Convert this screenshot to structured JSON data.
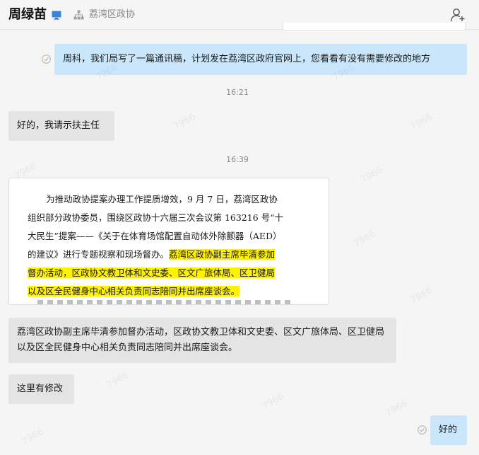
{
  "header": {
    "contact_name": "周绿苗",
    "org_name": "荔湾区政协"
  },
  "messages": {
    "m1": "周科，我们局写了一篇通讯稿，计划发在荔湾区政府官网上，您看看有没有需要修改的地方",
    "t1": "16:21",
    "m2": "好的，我请示扶主任",
    "t2": "16:39",
    "m3": "荔湾区政协副主席毕清参加督办活动，区政协文教卫体和文史委、区文广旅体局、区卫健局以及区全民健身中心相关负责同志陪同并出席座谈会。",
    "m4": "这里有修改",
    "m5": "好的"
  },
  "document_image": {
    "line1": "为推动政协提案办理工作提质增效，9 月 7 日，荔湾区政协",
    "line2": "组织部分政协委员，围绕区政协十六届三次会议第 163216 号“十",
    "line3": "大民生”提案——《关于在体育场馆配置自动体外除颤器（AED）",
    "line4_plain": "的建议》进行专题视察和现场督办。",
    "line4_hl": "荔湾区政协副主席毕清参加",
    "line5_hl": "督办活动，区政协文教卫体和文史委、区文广旅体局、区卫健局",
    "line6_hl": "以及区全民健身中心相关负责同志陪同并出席座谈会。"
  },
  "watermark_text": "7966",
  "colors": {
    "my_bubble": "#c9e6fb",
    "their_bubble": "#e4e4e4",
    "highlight": "#fff200"
  }
}
